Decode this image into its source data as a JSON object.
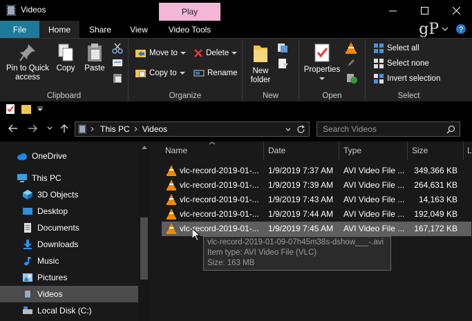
{
  "window": {
    "title": "Videos",
    "context_group": "Play",
    "controls": [
      "minimize",
      "maximize",
      "close"
    ]
  },
  "tabs": {
    "file": "File",
    "home": "Home",
    "share": "Share",
    "view": "View",
    "video_tools": "Video Tools"
  },
  "brand_logo": "gP",
  "ribbon": {
    "clipboard": {
      "label": "Clipboard",
      "pin": "Pin to Quick access",
      "pin_line1": "Pin to Quick",
      "pin_line2": "access",
      "copy": "Copy",
      "paste": "Paste"
    },
    "organize": {
      "label": "Organize",
      "move_to": "Move to",
      "copy_to": "Copy to",
      "delete": "Delete",
      "rename": "Rename"
    },
    "new": {
      "label": "New",
      "new_folder_line1": "New",
      "new_folder_line2": "folder"
    },
    "open": {
      "label": "Open",
      "properties": "Properties"
    },
    "select": {
      "label": "Select",
      "select_all": "Select all",
      "select_none": "Select none",
      "invert": "Invert selection"
    }
  },
  "address": {
    "crumbs": [
      "This PC",
      "Videos"
    ],
    "search_placeholder": "Search Videos"
  },
  "nav": {
    "items": [
      {
        "label": "OneDrive",
        "icon": "cloud-icon"
      },
      {
        "label": "This PC",
        "icon": "computer-icon"
      },
      {
        "label": "3D Objects",
        "icon": "cube-icon"
      },
      {
        "label": "Desktop",
        "icon": "desktop-icon"
      },
      {
        "label": "Documents",
        "icon": "documents-icon"
      },
      {
        "label": "Downloads",
        "icon": "download-icon"
      },
      {
        "label": "Music",
        "icon": "music-icon"
      },
      {
        "label": "Pictures",
        "icon": "pictures-icon"
      },
      {
        "label": "Videos",
        "icon": "videos-icon"
      },
      {
        "label": "Local Disk (C:)",
        "icon": "disk-icon"
      }
    ]
  },
  "columns": {
    "name": "Name",
    "date": "Date",
    "type": "Type",
    "size": "Size",
    "extra": "L"
  },
  "files": [
    {
      "name": "vlc-record-2019-01-...",
      "date": "1/9/2019 7:37 AM",
      "type": "AVI Video File ...",
      "size": "349,366 KB"
    },
    {
      "name": "vlc-record-2019-01-...",
      "date": "1/9/2019 7:39 AM",
      "type": "AVI Video File ...",
      "size": "264,631 KB"
    },
    {
      "name": "vlc-record-2019-01-...",
      "date": "1/9/2019 7:43 AM",
      "type": "AVI Video File ...",
      "size": "14,163 KB"
    },
    {
      "name": "vlc-record-2019-01-...",
      "date": "1/9/2019 7:44 AM",
      "type": "AVI Video File ...",
      "size": "192,049 KB"
    },
    {
      "name": "vlc-record-2019-01-...",
      "date": "1/9/2019 7:45 AM",
      "type": "AVI Video File ...",
      "size": "167,172 KB"
    }
  ],
  "tooltip": {
    "line1": "vlc-record-2019-01-09-07h45m38s-dshow___-.avi",
    "line2": "Item type: AVI Video File (VLC)",
    "line3": "Size: 163 MB"
  },
  "colors": {
    "file_tab": "#1e7a9a",
    "context_tab": "#f4b6d6",
    "selected_row": "#5f5f5f",
    "vlc_orange": "#f08a00"
  }
}
